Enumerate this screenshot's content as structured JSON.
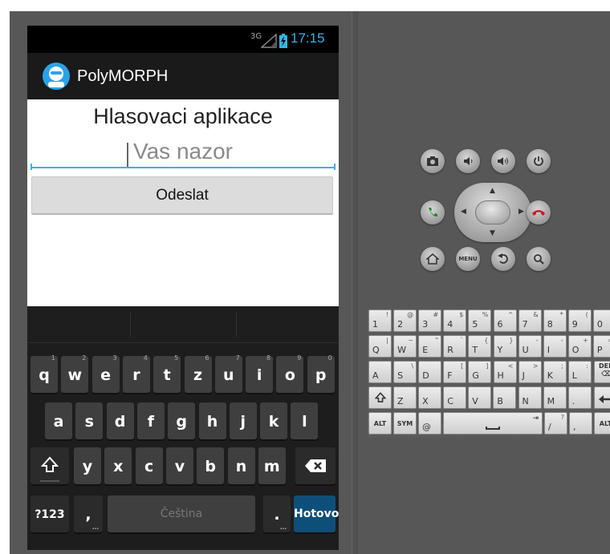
{
  "status": {
    "network": "3G",
    "time": "17:15"
  },
  "app": {
    "title": "PolyMORPH"
  },
  "form": {
    "heading": "Hlasovaci aplikace",
    "input_placeholder": "Vas nazor",
    "submit_label": "Odeslat"
  },
  "keyboard": {
    "row1": [
      {
        "k": "q",
        "a": "1"
      },
      {
        "k": "w",
        "a": "2"
      },
      {
        "k": "e",
        "a": "3"
      },
      {
        "k": "r",
        "a": "4"
      },
      {
        "k": "t",
        "a": "5"
      },
      {
        "k": "z",
        "a": "6"
      },
      {
        "k": "u",
        "a": "7"
      },
      {
        "k": "i",
        "a": "8"
      },
      {
        "k": "o",
        "a": "9"
      },
      {
        "k": "p",
        "a": "0"
      }
    ],
    "row2": [
      "a",
      "s",
      "d",
      "f",
      "g",
      "h",
      "j",
      "k",
      "l"
    ],
    "row3": [
      "y",
      "x",
      "c",
      "v",
      "b",
      "n",
      "m"
    ],
    "symbols_key": "?123",
    "comma_key": ",",
    "space_label": "Čeština",
    "period_key": ".",
    "done_key": "Hotovo"
  },
  "hardware_buttons": {
    "menu_label": "MENU"
  },
  "hardware_keyboard": {
    "rows": [
      [
        {
          "m": "1",
          "s": "!"
        },
        {
          "m": "2",
          "s": "@"
        },
        {
          "m": "3",
          "s": "#"
        },
        {
          "m": "4",
          "s": "$"
        },
        {
          "m": "5",
          "s": "%"
        },
        {
          "m": "6",
          "s": "^"
        },
        {
          "m": "7",
          "s": "&"
        },
        {
          "m": "8",
          "s": "*"
        },
        {
          "m": "9",
          "s": "("
        },
        {
          "m": "0",
          "s": ")"
        }
      ],
      [
        {
          "m": "Q",
          "s": "|"
        },
        {
          "m": "W",
          "s": "~"
        },
        {
          "m": "E",
          "s": "\""
        },
        {
          "m": "R",
          "s": "`"
        },
        {
          "m": "T",
          "s": "{"
        },
        {
          "m": "Y",
          "s": "}"
        },
        {
          "m": "U",
          "s": "-"
        },
        {
          "m": "I",
          "s": "-"
        },
        {
          "m": "O",
          "s": "+"
        },
        {
          "m": "P",
          "s": "="
        }
      ],
      [
        {
          "m": "A",
          "s": ""
        },
        {
          "m": "S",
          "s": "\\"
        },
        {
          "m": "D",
          "s": ""
        },
        {
          "m": "F",
          "s": "["
        },
        {
          "m": "G",
          "s": "]"
        },
        {
          "m": "H",
          "s": "<"
        },
        {
          "m": "J",
          "s": ">"
        },
        {
          "m": "K",
          "s": ";"
        },
        {
          "m": "L",
          "s": ":"
        }
      ],
      [
        {
          "m": "Z",
          "s": ""
        },
        {
          "m": "X",
          "s": ""
        },
        {
          "m": "C",
          "s": ""
        },
        {
          "m": "V",
          "s": ""
        },
        {
          "m": "B",
          "s": ""
        },
        {
          "m": "N",
          "s": ""
        },
        {
          "m": "M",
          "s": ""
        },
        {
          "m": ".",
          "s": ""
        }
      ],
      [
        {
          "m": "@",
          "s": ""
        },
        {
          "m": "/",
          "s": "?"
        },
        {
          "m": ",",
          "s": ""
        }
      ]
    ],
    "del_label": "DEL",
    "alt_label": "ALT",
    "sym_label": "SYM"
  }
}
